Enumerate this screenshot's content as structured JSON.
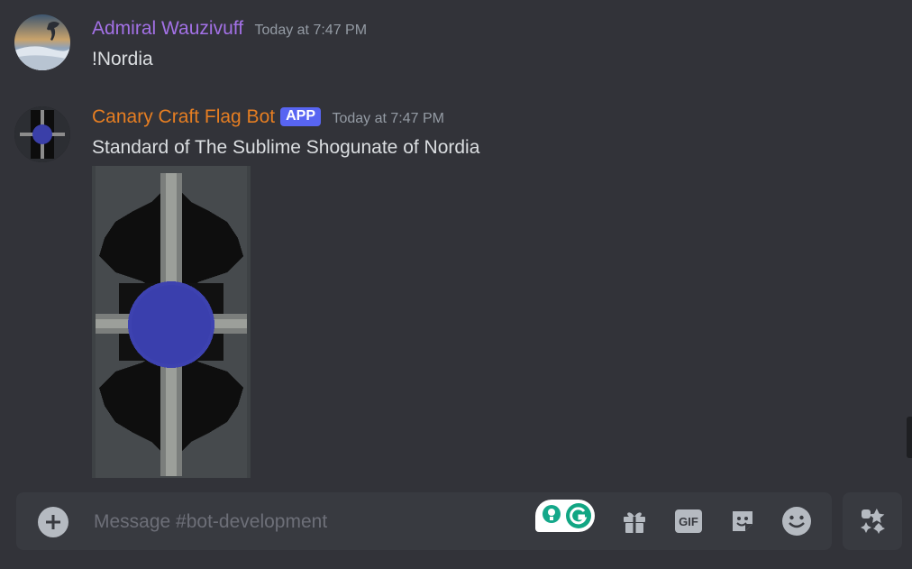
{
  "messages": [
    {
      "author": "Admiral Wauzivuff",
      "author_color": "#a371e6",
      "timestamp": "Today at 7:47 PM",
      "content": "!Nordia",
      "avatar": "polar-bear-avatar"
    },
    {
      "author": "Canary Craft Flag Bot",
      "author_color": "#e67e22",
      "badge": "APP",
      "timestamp": "Today at 7:47 PM",
      "content": "Standard of The Sublime Shogunate of Nordia",
      "avatar": "flag-bot-avatar",
      "attachment": "nordia-banner-image"
    }
  ],
  "composer": {
    "placeholder": "Message #bot-development",
    "icons": [
      "add-icon",
      "grammarly-icon",
      "gift-icon",
      "gif-icon",
      "sticker-icon",
      "emoji-icon",
      "apps-icon"
    ],
    "gif_label": "GIF"
  },
  "colors": {
    "background": "#323339",
    "composer": "#383a40",
    "badge": "#5865f2"
  }
}
